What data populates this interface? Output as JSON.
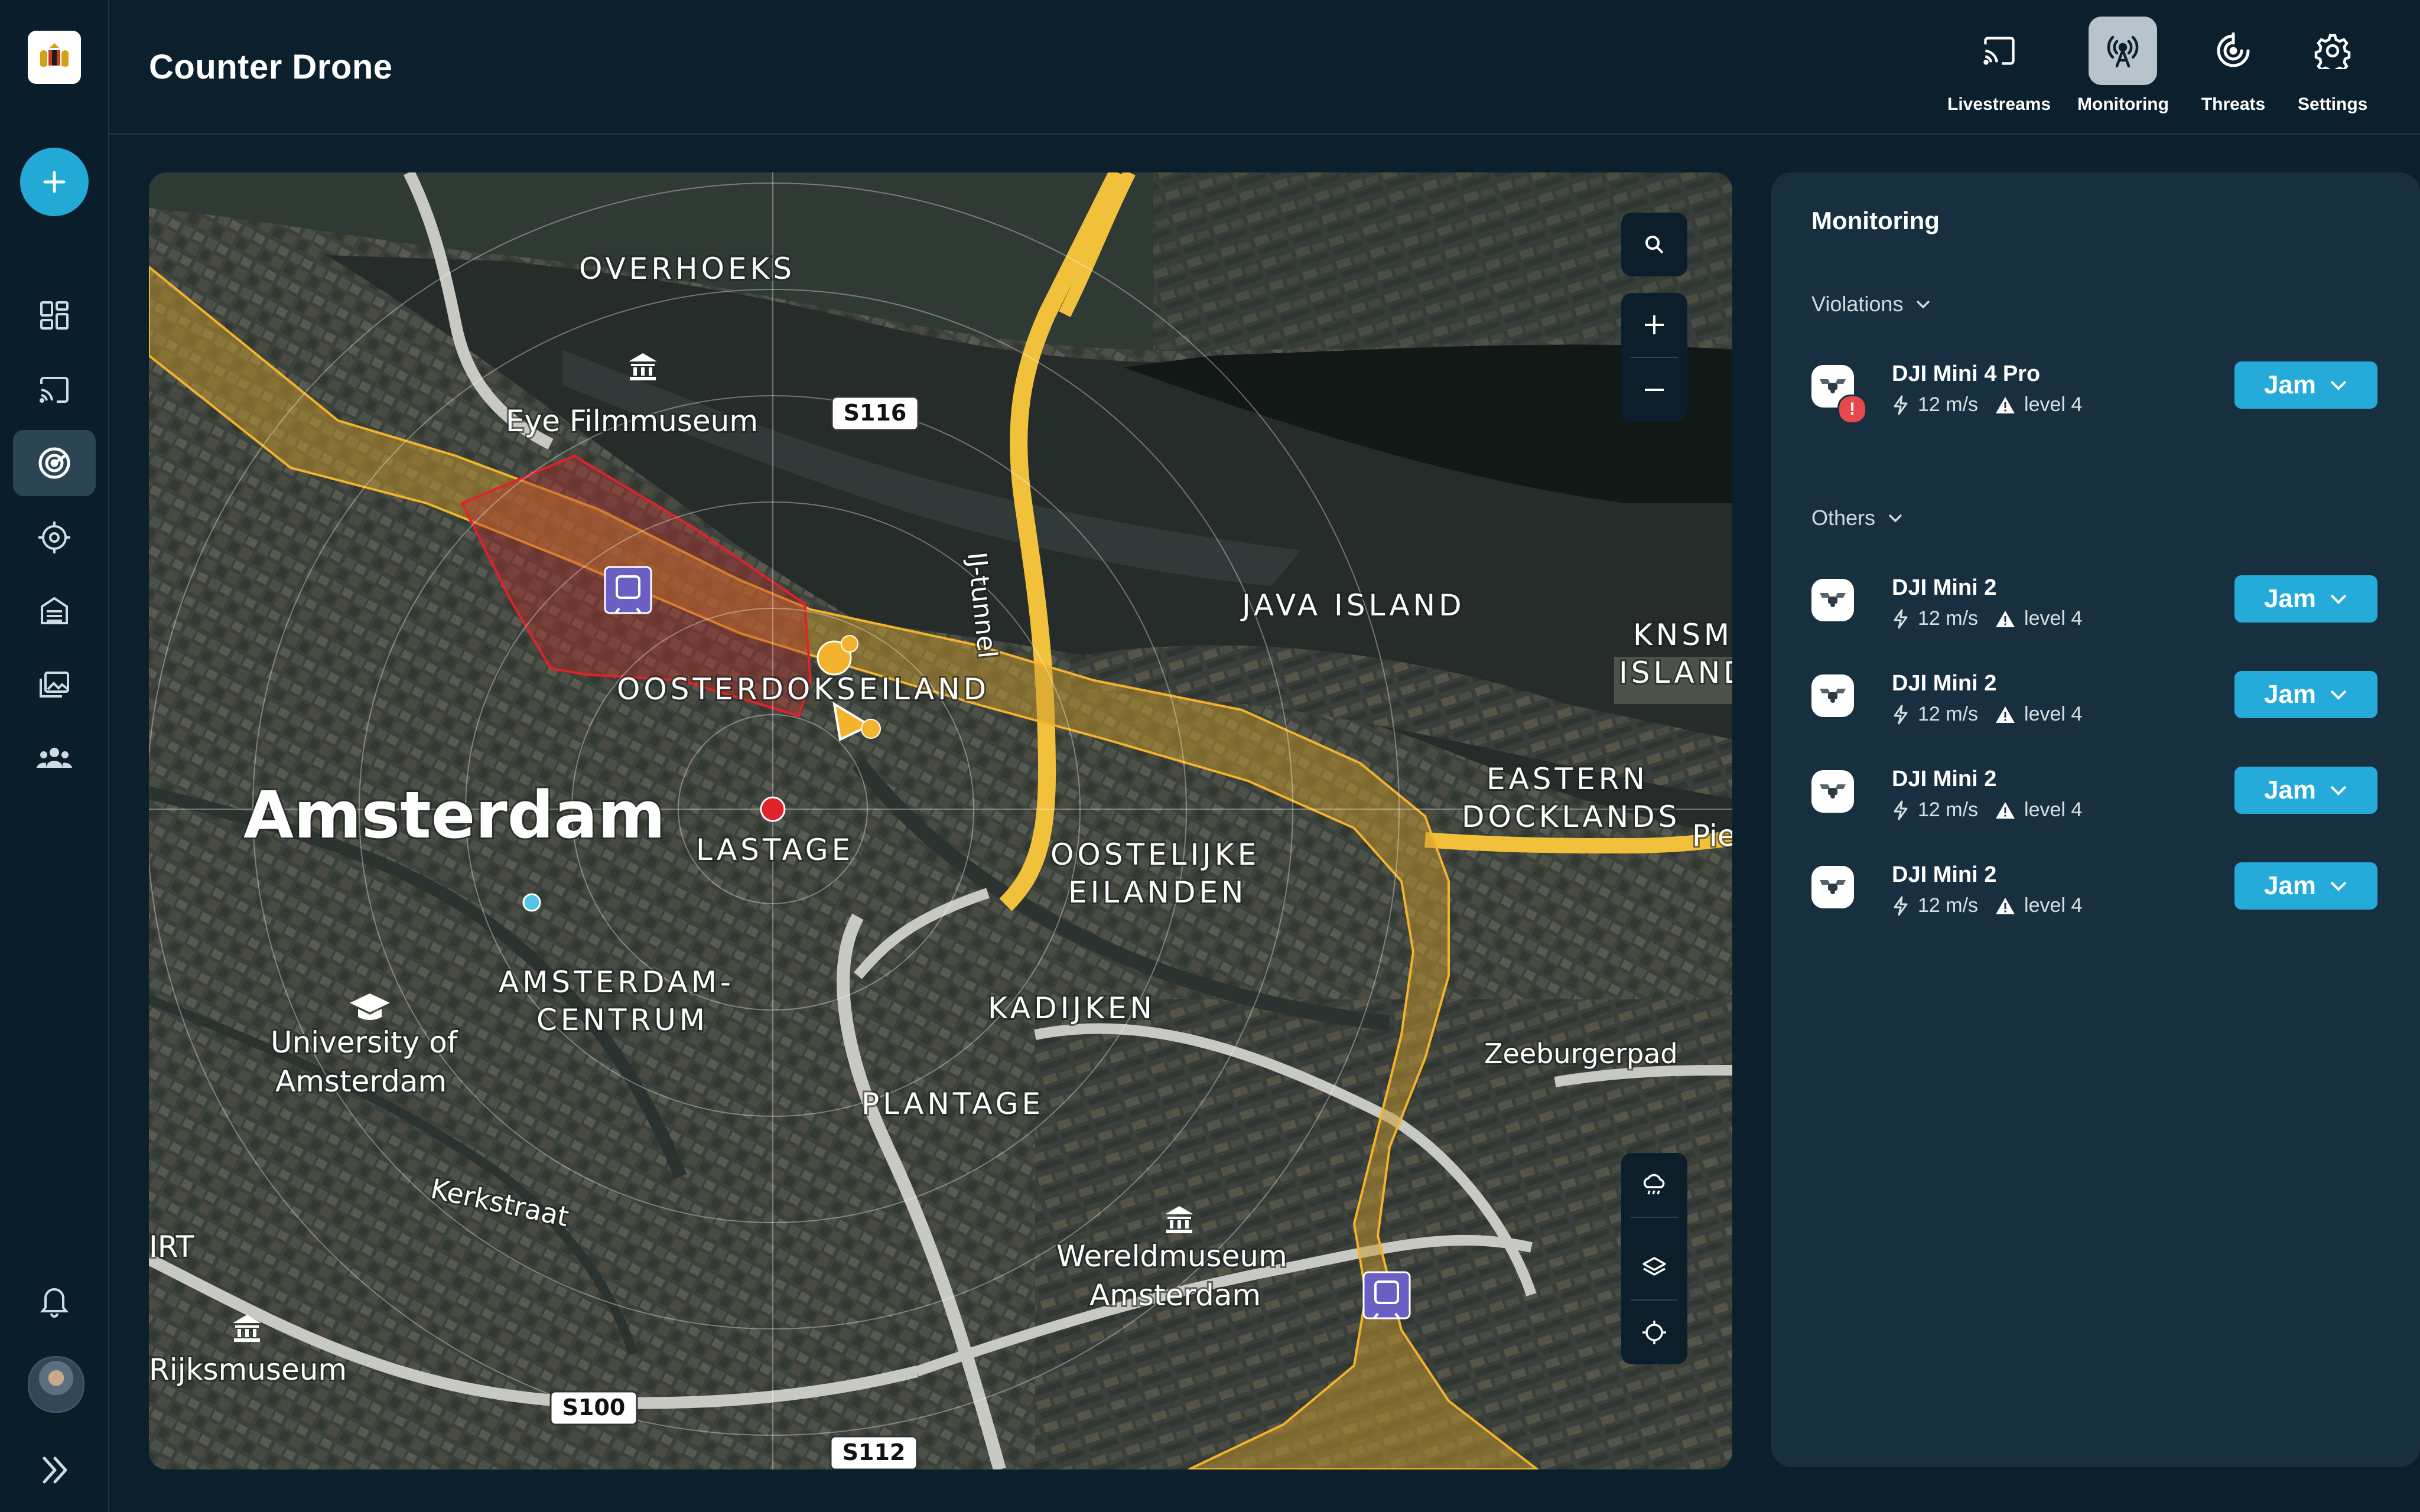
{
  "app": {
    "title": "Counter Drone"
  },
  "topnav": [
    {
      "label": "Livestreams",
      "icon": "cast-icon"
    },
    {
      "label": "Monitoring",
      "icon": "antenna-icon",
      "active": true
    },
    {
      "label": "Threats",
      "icon": "target-icon"
    },
    {
      "label": "Settings",
      "icon": "gear-icon"
    }
  ],
  "sidebar": {
    "items": [
      {
        "name": "dashboard-icon"
      },
      {
        "name": "cast-icon"
      },
      {
        "name": "radar-icon",
        "active": true
      },
      {
        "name": "crosshair-icon"
      },
      {
        "name": "building-icon"
      },
      {
        "name": "gallery-icon"
      },
      {
        "name": "team-icon"
      }
    ]
  },
  "map": {
    "labels": {
      "overhoeks": "OVERHOEKS",
      "eye": "Eye Filmmuseum",
      "s116": "S116",
      "ijtunnel": "IJ-tunnel",
      "java": "JAVA ISLAND",
      "knsm1": "KNSM",
      "knsm2": "ISLAND",
      "oosterdok": "OOSTERDOKSEILAND",
      "eastern1": "EASTERN",
      "eastern2": "DOCKLANDS",
      "pie": "Pie",
      "amsterdam": "Amsterdam",
      "lastage": "LASTAGE",
      "oostelijke1": "OOSTELIJKE",
      "oostelijke2": "EILANDEN",
      "centrum1": "AMSTERDAM-",
      "centrum2": "CENTRUM",
      "kadijken": "KADIJKEN",
      "univ1": "University of",
      "univ2": "Amsterdam",
      "zeeburgerpad": "Zeeburgerpad",
      "plantage": "PLANTAGE",
      "kerkstraat": "Kerkstraat",
      "irt": "IRT",
      "wereld1": "Wereldmuseum",
      "wereld2": "Amsterdam",
      "rijks": "Rijksmuseum",
      "s100": "S100",
      "s112": "S112"
    }
  },
  "panel": {
    "title": "Monitoring",
    "violations": {
      "label": "Violations",
      "items": [
        {
          "name": "DJI Mini 4 Pro",
          "speed": "12 m/s",
          "level": "level 4",
          "action": "Jam",
          "alert": "!"
        }
      ]
    },
    "others": {
      "label": "Others",
      "items": [
        {
          "name": "DJI Mini 2",
          "speed": "12 m/s",
          "level": "level 4",
          "action": "Jam"
        },
        {
          "name": "DJI Mini 2",
          "speed": "12 m/s",
          "level": "level 4",
          "action": "Jam"
        },
        {
          "name": "DJI Mini 2",
          "speed": "12 m/s",
          "level": "level 4",
          "action": "Jam"
        },
        {
          "name": "DJI Mini 2",
          "speed": "12 m/s",
          "level": "level 4",
          "action": "Jam"
        }
      ]
    }
  },
  "colors": {
    "accent": "#25abd9",
    "background": "#0b1f2c",
    "panel": "#182f3f",
    "alert": "#e5484d",
    "zone_yellow": "#f3b32c",
    "zone_red": "#e0232a"
  }
}
